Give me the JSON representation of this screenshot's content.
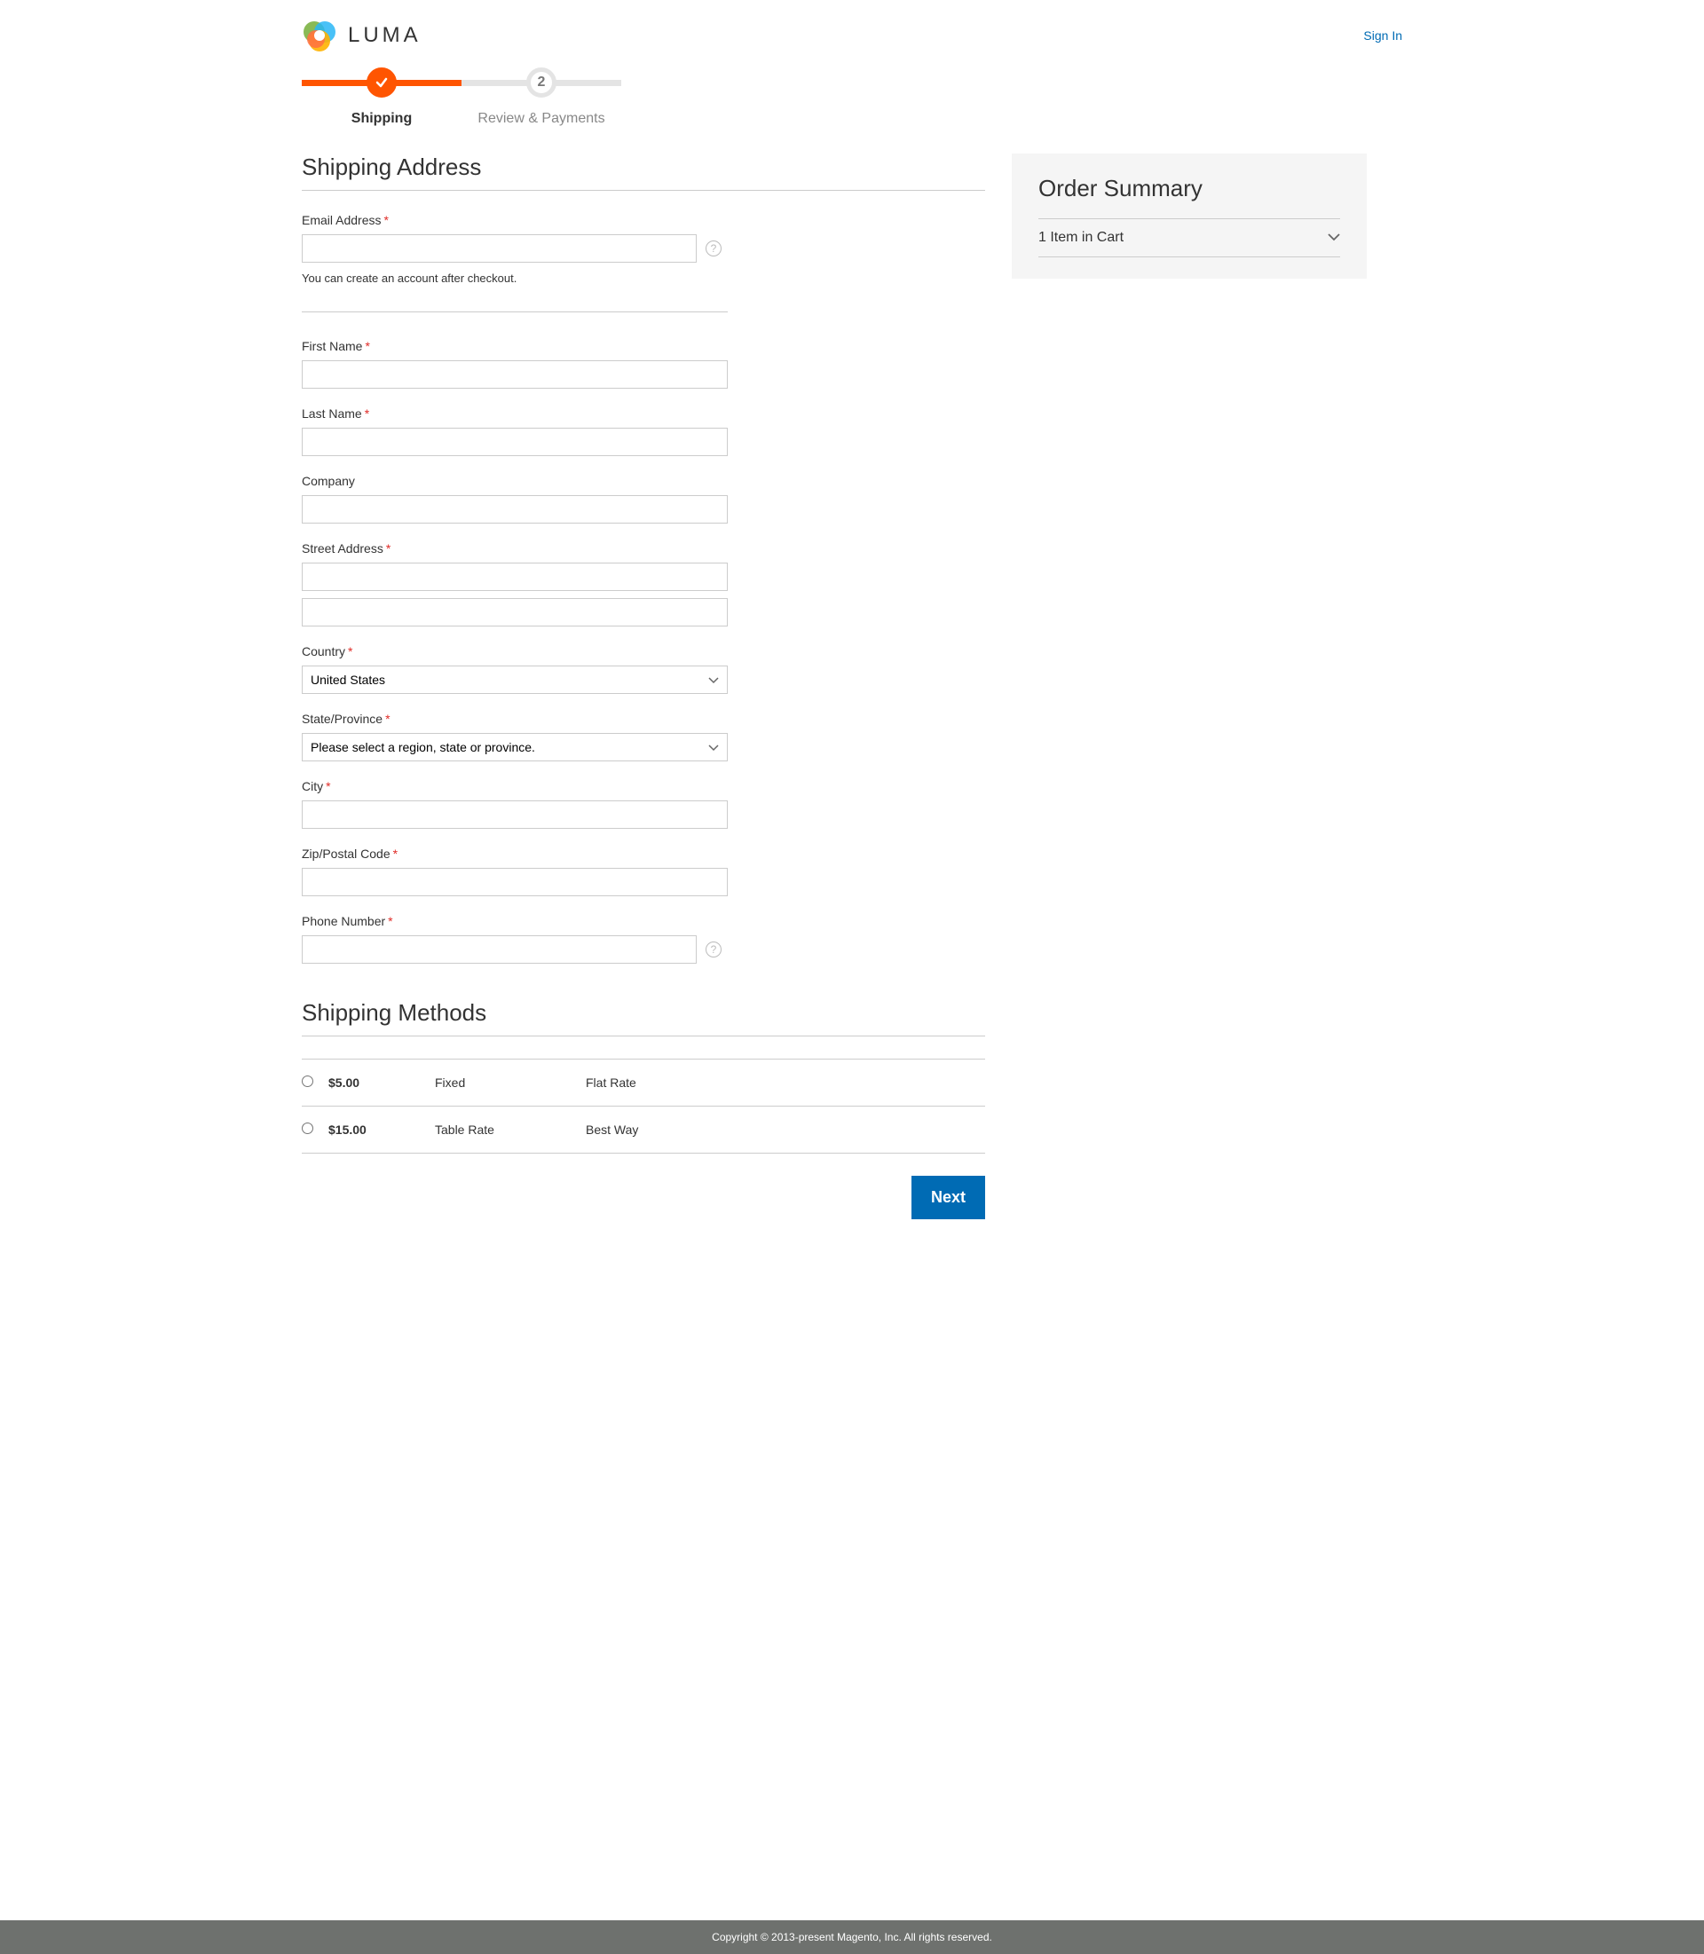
{
  "header": {
    "brand": "LUMA",
    "signin": "Sign In"
  },
  "progress": {
    "step1": {
      "label": "Shipping"
    },
    "step2": {
      "number": "2",
      "label": "Review & Payments"
    }
  },
  "shipping_address": {
    "title": "Shipping Address",
    "fields": {
      "email": {
        "label": "Email Address",
        "value": "",
        "note": "You can create an account after checkout."
      },
      "firstname": {
        "label": "First Name",
        "value": ""
      },
      "lastname": {
        "label": "Last Name",
        "value": ""
      },
      "company": {
        "label": "Company",
        "value": ""
      },
      "street": {
        "label": "Street Address",
        "value1": "",
        "value2": ""
      },
      "country": {
        "label": "Country",
        "selected": "United States"
      },
      "region": {
        "label": "State/Province",
        "selected": "Please select a region, state or province."
      },
      "city": {
        "label": "City",
        "value": ""
      },
      "postcode": {
        "label": "Zip/Postal Code",
        "value": ""
      },
      "phone": {
        "label": "Phone Number",
        "value": ""
      }
    }
  },
  "shipping_methods": {
    "title": "Shipping Methods",
    "rows": [
      {
        "price": "$5.00",
        "method": "Fixed",
        "carrier": "Flat Rate"
      },
      {
        "price": "$15.00",
        "method": "Table Rate",
        "carrier": "Best Way"
      }
    ]
  },
  "actions": {
    "next": "Next"
  },
  "summary": {
    "title": "Order Summary",
    "cart_toggle": "1 Item in Cart"
  },
  "footer": {
    "copyright": "Copyright © 2013-present Magento, Inc. All rights reserved."
  }
}
